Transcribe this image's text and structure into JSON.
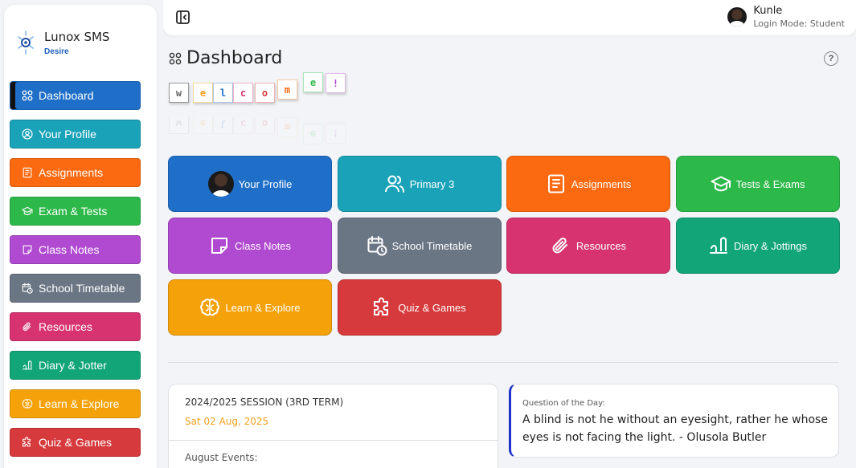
{
  "brand": {
    "name": "Lunox SMS",
    "subtitle": "Desire"
  },
  "sidebar": {
    "items": [
      {
        "label": "Dashboard",
        "icon": "grid-icon",
        "color": "#1f6fc9",
        "active": true
      },
      {
        "label": "Your Profile",
        "icon": "user-circle-icon",
        "color": "#1aa3b8"
      },
      {
        "label": "Assignments",
        "icon": "document-icon",
        "color": "#fb6a10"
      },
      {
        "label": "Exam & Tests",
        "icon": "graduation-cap-icon",
        "color": "#2db84a"
      },
      {
        "label": "Class Notes",
        "icon": "sticky-note-icon",
        "color": "#b04ad0"
      },
      {
        "label": "School Timetable",
        "icon": "calendar-clock-icon",
        "color": "#6b7685"
      },
      {
        "label": "Resources",
        "icon": "paperclip-icon",
        "color": "#d63370"
      },
      {
        "label": "Diary & Jotter",
        "icon": "pen-writing-icon",
        "color": "#12a578"
      },
      {
        "label": "Learn & Explore",
        "icon": "brain-icon",
        "color": "#f5a20a"
      },
      {
        "label": "Quiz & Games",
        "icon": "puzzle-icon",
        "color": "#d63a3d"
      }
    ]
  },
  "topbar": {
    "user_name": "Kunle",
    "login_mode": "Login Mode: Student"
  },
  "page": {
    "title": "Dashboard",
    "help": "?"
  },
  "welcome": {
    "letters": [
      {
        "char": "w",
        "color": "#666666",
        "border": "#999999"
      },
      {
        "char": "e",
        "color": "#f0a020",
        "border": "#f5d79a"
      },
      {
        "char": "l",
        "color": "#1f6fc9",
        "border": "#a9c4ea"
      },
      {
        "char": "c",
        "color": "#d63370",
        "border": "#f0b3c8"
      },
      {
        "char": "o",
        "color": "#d63a3d",
        "border": "#f0b3b4"
      },
      {
        "char": "m",
        "color": "#fb6a10",
        "border": "#fbc9a4"
      },
      {
        "char": "e",
        "color": "#2db84a",
        "border": "#a9e4b6"
      },
      {
        "char": "!",
        "color": "#b04ad0",
        "border": "#dfb8ec"
      }
    ]
  },
  "tiles": [
    {
      "label": "Your Profile",
      "icon": "profile-photo-icon",
      "color": "#1f6fc9"
    },
    {
      "label": "Primary 3",
      "icon": "users-icon",
      "color": "#1aa3b8"
    },
    {
      "label": "Assignments",
      "icon": "document-icon",
      "color": "#fb6a10"
    },
    {
      "label": "Tests & Exams",
      "icon": "graduation-cap-icon",
      "color": "#2db84a"
    },
    {
      "label": "Class Notes",
      "icon": "sticky-note-icon",
      "color": "#b04ad0"
    },
    {
      "label": "School Timetable",
      "icon": "calendar-clock-icon",
      "color": "#6b7685"
    },
    {
      "label": "Resources",
      "icon": "paperclip-icon",
      "color": "#d63370"
    },
    {
      "label": "Diary & Jottings",
      "icon": "pen-writing-icon",
      "color": "#12a578"
    },
    {
      "label": "Learn & Explore",
      "icon": "brain-icon",
      "color": "#f5a20a"
    },
    {
      "label": "Quiz & Games",
      "icon": "puzzle-icon",
      "color": "#d63a3d"
    }
  ],
  "session": {
    "title": "2024/2025 SESSION (3RD TERM)",
    "date": "Sat 02 Aug, 2025",
    "events_title": "August Events:"
  },
  "qotd": {
    "label": "Question of the Day:",
    "text": "A blind is not he without an eyesight, rather he whose eyes is not facing the light. - Olusola Butler"
  }
}
